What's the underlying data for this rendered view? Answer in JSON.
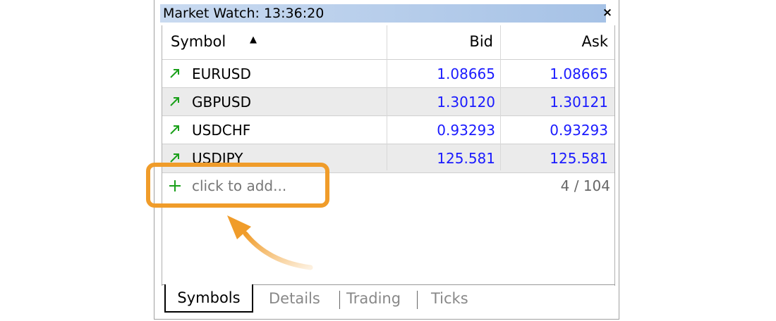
{
  "window": {
    "title": "Market Watch: 13:36:20",
    "close_glyph": "×"
  },
  "table": {
    "columns": {
      "symbol": "Symbol",
      "symbol_sort_glyph": "▲",
      "bid": "Bid",
      "ask": "Ask"
    },
    "rows": [
      {
        "symbol": "EURUSD",
        "bid": "1.08665",
        "ask": "1.08665",
        "trend_icon": "arrow-up-right-icon"
      },
      {
        "symbol": "GBPUSD",
        "bid": "1.30120",
        "ask": "1.30121",
        "trend_icon": "arrow-up-right-icon"
      },
      {
        "symbol": "USDCHF",
        "bid": "0.93293",
        "ask": "0.93293",
        "trend_icon": "arrow-up-right-icon"
      },
      {
        "symbol": "USDJPY",
        "bid": "125.581",
        "ask": "125.581",
        "trend_icon": "arrow-up-right-icon"
      }
    ],
    "add_row": {
      "label": "click to add...",
      "icon": "plus-icon",
      "count": "4 / 104"
    }
  },
  "tabs": [
    {
      "label": "Symbols",
      "active": true
    },
    {
      "label": "Details",
      "active": false
    },
    {
      "label": "Trading",
      "active": false
    },
    {
      "label": "Ticks",
      "active": false
    }
  ],
  "colors": {
    "price": "#1a1aff",
    "trend_up": "#1aa01a",
    "highlight": "#f09c2a",
    "titlebar": "#a6c2e6"
  }
}
